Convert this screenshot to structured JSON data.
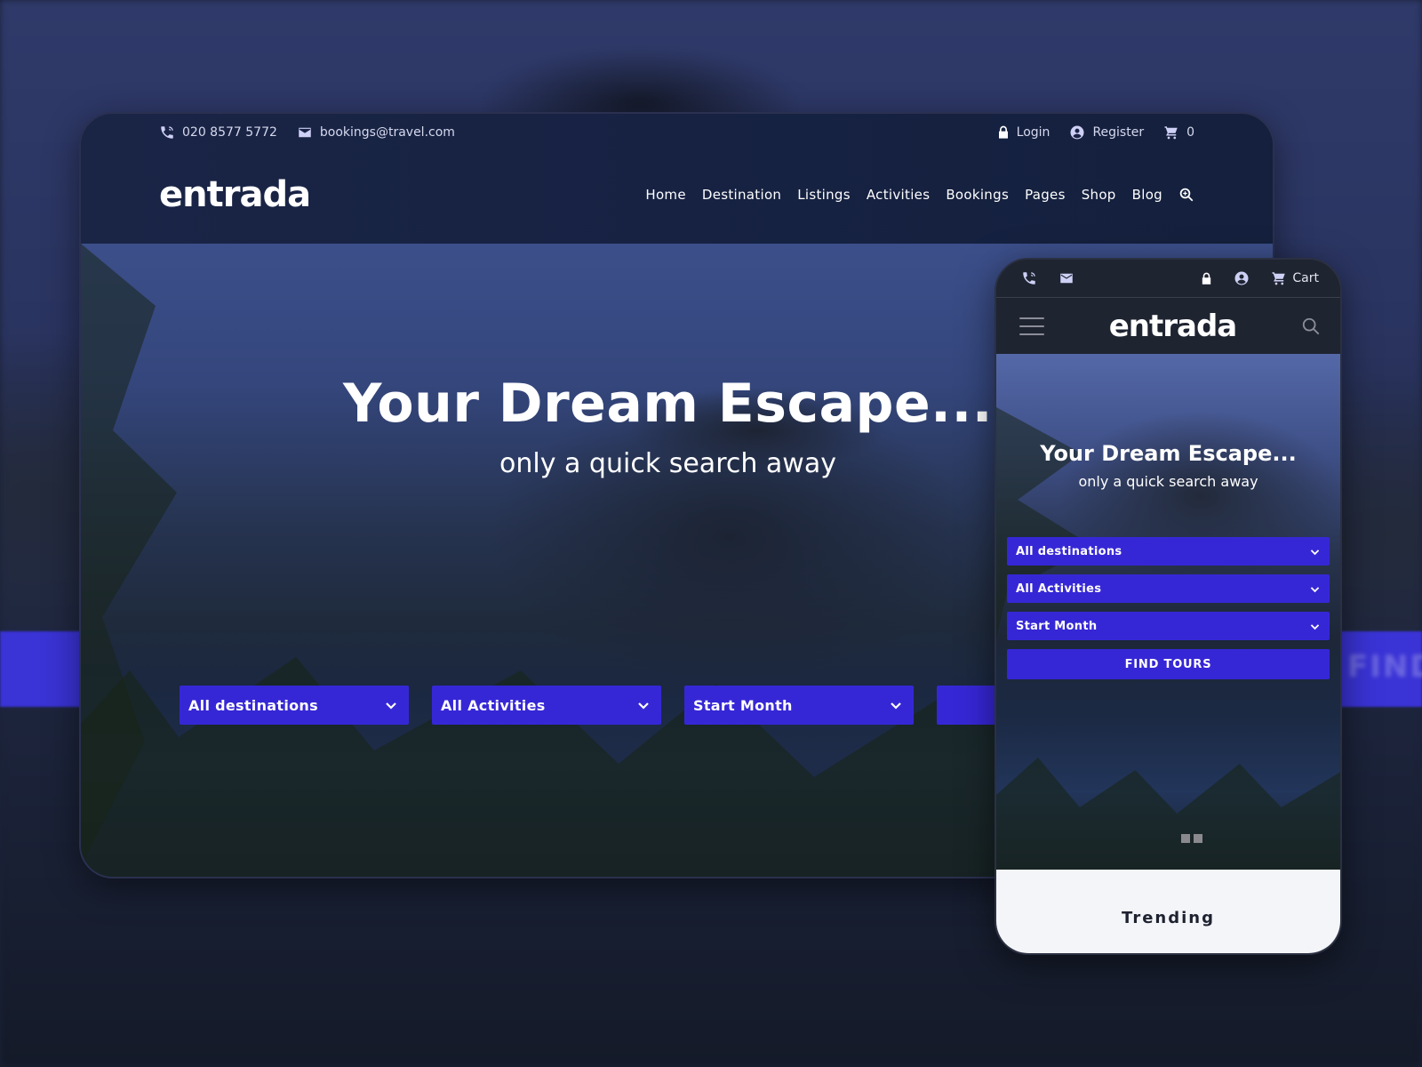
{
  "colors": {
    "accent": "#3627d6",
    "header_bg": "#172243",
    "mobile_header_bg": "#1f2431",
    "icon_tint": "#cfd0f5",
    "trending_bg": "#f4f5f9"
  },
  "desktop": {
    "topbar": {
      "phone_icon": "phone-icon",
      "phone": "020 8577 5772",
      "email_icon": "mail-icon",
      "email": "bookings@travel.com",
      "login_icon": "lock-icon",
      "login": "Login",
      "register_icon": "user-circle-icon",
      "register": "Register",
      "cart_icon": "cart-icon",
      "cart_count": "0"
    },
    "logo": "entrada",
    "nav": [
      {
        "label": "Home"
      },
      {
        "label": "Destination"
      },
      {
        "label": "Listings"
      },
      {
        "label": "Activities"
      },
      {
        "label": "Bookings"
      },
      {
        "label": "Pages"
      },
      {
        "label": "Shop"
      },
      {
        "label": "Blog"
      }
    ],
    "search_icon": "search-icon",
    "hero": {
      "title": "Your Dream Escape...",
      "subtitle": "only a quick search away"
    },
    "search": {
      "destinations": "All destinations",
      "activities": "All Activities",
      "start_month": "Start Month"
    }
  },
  "mobile": {
    "topbar": {
      "cart_label": "Cart"
    },
    "logo": "entrada",
    "hero": {
      "title": "Your Dream Escape...",
      "subtitle": "only a quick search away"
    },
    "search": {
      "destinations": "All destinations",
      "activities": "All Activities",
      "start_month": "Start Month",
      "button": "FIND TOURS"
    },
    "slider_dots": 2,
    "section_title": "Trending"
  },
  "backdrop": {
    "partial_text": "FIND"
  }
}
